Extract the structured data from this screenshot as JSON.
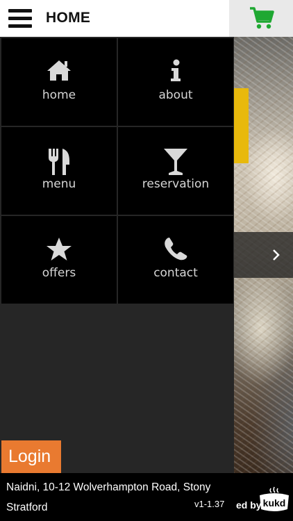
{
  "header": {
    "title": "HOME"
  },
  "menu": {
    "items": [
      {
        "label": "home",
        "icon": "house-icon"
      },
      {
        "label": "about",
        "icon": "info-icon"
      },
      {
        "label": "menu",
        "icon": "cutlery-icon"
      },
      {
        "label": "reservation",
        "icon": "cocktail-icon"
      },
      {
        "label": "offers",
        "icon": "star-icon"
      },
      {
        "label": "contact",
        "icon": "phone-icon"
      }
    ]
  },
  "login": {
    "label": "Login"
  },
  "footer": {
    "address": "Naidni, 10-12 Wolverhampton Road, Stony Stratford",
    "version": "v1-1.37",
    "powered_by": "ed by",
    "logo_text": "kukd"
  },
  "colors": {
    "cart": "#1fa832",
    "login": "#e97a30",
    "accent_bar": "#e8b90c",
    "tile": "#000000",
    "drawer": "#262626"
  }
}
